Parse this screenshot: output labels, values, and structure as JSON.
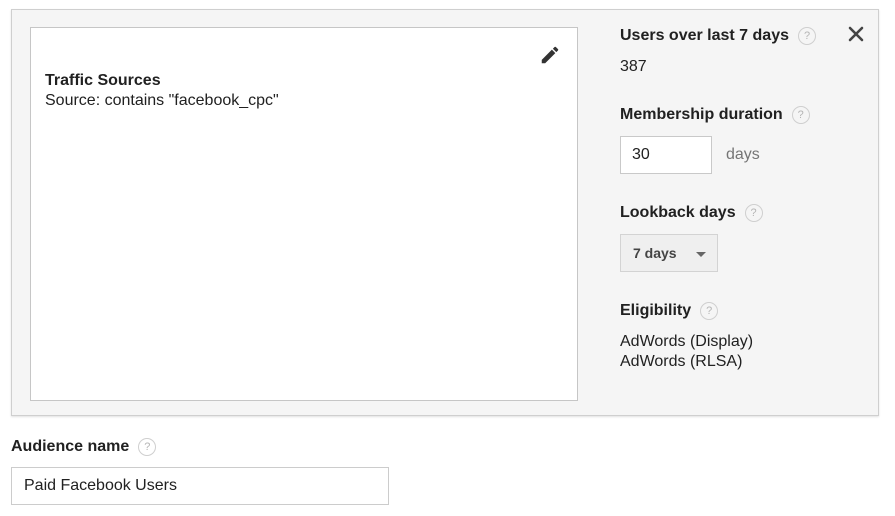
{
  "definition": {
    "title": "Traffic Sources",
    "condition": "Source: contains \"facebook_cpc\""
  },
  "icons": {
    "edit": "pencil-icon",
    "close": "close-icon",
    "help": "help-icon",
    "help_glyph": "?"
  },
  "users": {
    "label": "Users over last 7 days",
    "value": "387"
  },
  "membership": {
    "label": "Membership duration",
    "value": "30",
    "unit": "days"
  },
  "lookback": {
    "label": "Lookback days",
    "selected": "7 days"
  },
  "eligibility": {
    "label": "Eligibility",
    "items": [
      "AdWords (Display)",
      "AdWords (RLSA)"
    ]
  },
  "audience": {
    "label": "Audience name",
    "value": "Paid Facebook Users"
  },
  "colors": {
    "panel_background": "#f5f5f5",
    "border": "#cfcfcf",
    "text": "#212121",
    "muted": "#757575"
  }
}
